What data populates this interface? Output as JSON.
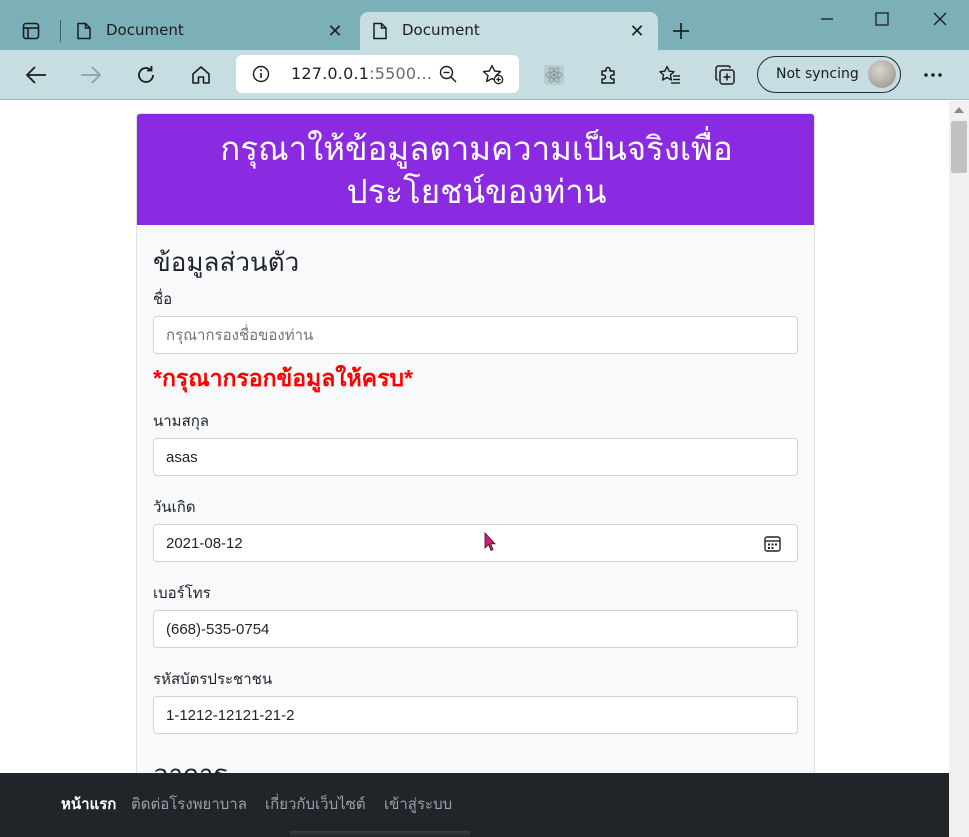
{
  "browser": {
    "tabs": [
      {
        "title": "Document",
        "active": false
      },
      {
        "title": "Document",
        "active": true
      }
    ],
    "address": {
      "url_main": "127.0.0.1",
      "url_rest": ":5500..."
    },
    "sync": {
      "label": "Not syncing"
    },
    "icons": {
      "tab_actions": "tab-actions-icon",
      "close": "close-icon",
      "new_tab": "plus-icon",
      "minimize": "minimize-icon",
      "maximize": "maximize-icon",
      "window_close": "window-close-icon",
      "back": "back-arrow-icon",
      "forward": "forward-arrow-icon",
      "refresh": "refresh-icon",
      "home": "home-icon",
      "info": "info-icon",
      "zoom": "zoom-out-icon",
      "favorite": "add-favorite-icon",
      "extension_atom": "react-devtools-icon",
      "extensions": "puzzle-icon",
      "favorites": "favorites-icon",
      "collections": "collections-icon",
      "more": "more-icon"
    }
  },
  "page": {
    "header": {
      "line1": "กรุณาให้ข้อมูลตามความเป็นจริงเพื่อ",
      "line2": "ประโยชน์ของท่าน"
    },
    "section_personal": "ข้อมูลส่วนตัว",
    "fields": {
      "first_name": {
        "label": "ชื่อ",
        "placeholder": "กรุณากรองชื่อของท่าน",
        "value": ""
      },
      "error": "*กรุณากรอกข้อมูลให้ครบ*",
      "last_name": {
        "label": "นามสกุล",
        "value": "asas"
      },
      "birthdate": {
        "label": "วันเกิด",
        "value": "2021-08-12"
      },
      "phone": {
        "label": "เบอร์โทร",
        "value": "(668)-535-0754"
      },
      "citizen_id": {
        "label": "รหัสบัตรประชาชน",
        "value": "1-1212-12121-21-2"
      }
    },
    "section_symptoms": "อาการ"
  },
  "navbar": {
    "items": [
      {
        "label": "หน้าแรก",
        "active": true
      },
      {
        "label": "ติดต่อโรงพยาบาล",
        "active": false
      },
      {
        "label": "เกี่ยวกับเว็บไซต์",
        "active": false
      },
      {
        "label": "เข้าสู่ระบบ",
        "active": false
      }
    ]
  },
  "colors": {
    "header_bg": "#8a2be2",
    "error": "#ff0000",
    "navbar_bg": "#212529",
    "chrome_titlebar": "#7cb0b9",
    "chrome_toolbar": "#c6dde1"
  }
}
